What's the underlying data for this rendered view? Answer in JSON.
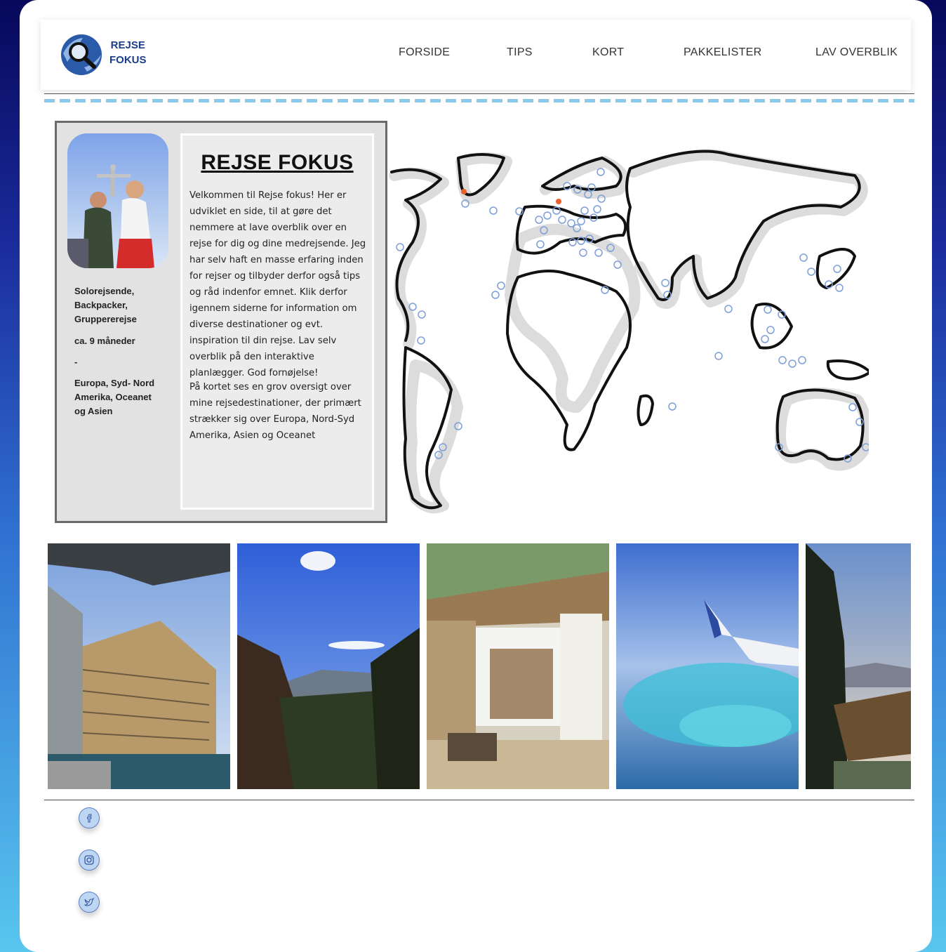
{
  "brand": {
    "line1": "REJSE",
    "line2": "FOKUS"
  },
  "nav": [
    "FORSIDE",
    "TIPS",
    "KORT",
    "PAKKELISTER",
    "LAV OVERBLIK"
  ],
  "profile": {
    "travel_types": [
      "Solorejsende,",
      "Backpacker,",
      "Gruppererejse"
    ],
    "duration": "ca. 9 måneder",
    "separator": "-",
    "regions": [
      "Europa, Syd- Nord",
      "Amerika, Oceanet",
      "og Asien"
    ]
  },
  "intro": {
    "title": "REJSE FOKUS",
    "p1": "Velkommen til Rejse fokus! Her er udviklet en side, til at gøre det nemmere at lave overblik over en rejse for dig og dine medrejsende. Jeg har selv haft en masse erfaring inden for rejser og tilbyder derfor også tips og råd indenfor emnet. Klik derfor igennem siderne for information om diverse destinationer og evt. inspiration til din rejse. Lav selv overblik på den interaktive planlægger. God fornøjelse!",
    "p2": "På kortet ses en grov oversigt over mine rejsedestinationer, der primært strækker sig over Europa, Nord-Syd Amerika, Asien og Oceanet"
  },
  "gallery": [
    "hotel-pool-photo",
    "mountain-valley-photo",
    "beach-cabana-photo",
    "airplane-wing-photo",
    "coastal-forest-photo"
  ],
  "social": [
    "facebook-icon",
    "instagram-icon",
    "twitter-icon"
  ],
  "colors": {
    "brand": "#1a3d8a",
    "dash": "#8cc8ea",
    "marker": "#e8612c",
    "pin": "#7c9fd8"
  }
}
